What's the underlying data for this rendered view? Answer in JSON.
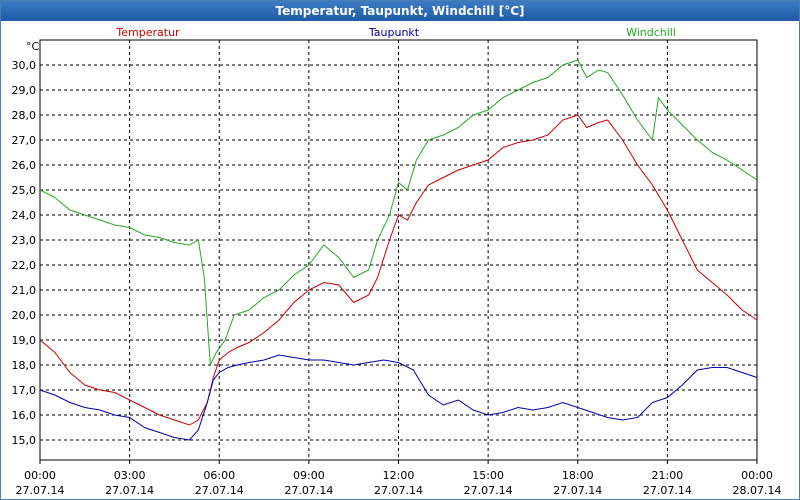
{
  "title": "Temperatur, Taupunkt, Windchill [°C]",
  "chart_data": {
    "type": "line",
    "unit_label": "°C",
    "ylim": [
      14.2,
      31.0
    ],
    "yticks": [
      15.0,
      16.0,
      17.0,
      18.0,
      19.0,
      20.0,
      21.0,
      22.0,
      23.0,
      24.0,
      25.0,
      26.0,
      27.0,
      28.0,
      29.0,
      30.0
    ],
    "ytick_labels": [
      "15,0",
      "16,0",
      "17,0",
      "18,0",
      "19,0",
      "20,0",
      "21,0",
      "22,0",
      "23,0",
      "24,0",
      "25,0",
      "26,0",
      "27,0",
      "28,0",
      "29,0",
      "30,0"
    ],
    "xlim": [
      0,
      24
    ],
    "xticks": [
      0,
      3,
      6,
      9,
      12,
      15,
      18,
      21,
      24
    ],
    "xtick_labels": [
      {
        "time": "00:00",
        "date": "27.07.14"
      },
      {
        "time": "03:00",
        "date": "27.07.14"
      },
      {
        "time": "06:00",
        "date": "27.07.14"
      },
      {
        "time": "09:00",
        "date": "27.07.14"
      },
      {
        "time": "12:00",
        "date": "27.07.14"
      },
      {
        "time": "15:00",
        "date": "27.07.14"
      },
      {
        "time": "18:00",
        "date": "27.07.14"
      },
      {
        "time": "21:00",
        "date": "27.07.14"
      },
      {
        "time": "00:00",
        "date": "28.07.14"
      }
    ],
    "grid": true,
    "legend": "top",
    "series": [
      {
        "name": "Temperatur",
        "color": "#cc0000",
        "x": [
          0,
          0.5,
          1,
          1.5,
          2,
          2.5,
          3,
          3.5,
          4,
          4.5,
          5,
          5.3,
          5.6,
          5.8,
          6,
          6.3,
          6.6,
          7,
          7.5,
          8,
          8.5,
          9,
          9.5,
          10,
          10.5,
          11,
          11.3,
          11.7,
          12,
          12.3,
          12.6,
          13,
          13.5,
          14,
          14.5,
          15,
          15.5,
          16,
          16.5,
          17,
          17.5,
          18,
          18.3,
          18.7,
          19,
          19.5,
          20,
          20.5,
          21,
          21.5,
          22,
          22.5,
          23,
          23.5,
          24
        ],
        "y": [
          19.0,
          18.5,
          17.7,
          17.2,
          17.0,
          16.9,
          16.6,
          16.3,
          16.0,
          15.8,
          15.6,
          15.8,
          16.5,
          17.5,
          18.2,
          18.5,
          18.7,
          18.9,
          19.3,
          19.8,
          20.5,
          21.0,
          21.3,
          21.2,
          20.5,
          20.8,
          21.5,
          23.0,
          24.0,
          23.8,
          24.5,
          25.2,
          25.5,
          25.8,
          26.0,
          26.2,
          26.7,
          26.9,
          27.0,
          27.2,
          27.8,
          28.0,
          27.5,
          27.7,
          27.8,
          27.0,
          26.0,
          25.2,
          24.2,
          23.0,
          21.8,
          21.3,
          20.8,
          20.2,
          19.8
        ]
      },
      {
        "name": "Taupunkt",
        "color": "#0000aa",
        "x": [
          0,
          0.5,
          1,
          1.5,
          2,
          2.5,
          3,
          3.5,
          4,
          4.5,
          5,
          5.3,
          5.6,
          5.8,
          6,
          6.3,
          6.6,
          7,
          7.5,
          8,
          8.5,
          9,
          9.5,
          10,
          10.5,
          11,
          11.5,
          12,
          12.5,
          13,
          13.5,
          14,
          14.5,
          15,
          15.5,
          16,
          16.5,
          17,
          17.5,
          18,
          18.5,
          19,
          19.5,
          20,
          20.5,
          21,
          21.5,
          22,
          22.5,
          23,
          23.5,
          24
        ],
        "y": [
          17.0,
          16.8,
          16.5,
          16.3,
          16.2,
          16.0,
          15.9,
          15.5,
          15.3,
          15.1,
          15.0,
          15.4,
          16.5,
          17.4,
          17.7,
          17.9,
          18.0,
          18.1,
          18.2,
          18.4,
          18.3,
          18.2,
          18.2,
          18.1,
          18.0,
          18.1,
          18.2,
          18.1,
          17.8,
          16.8,
          16.4,
          16.6,
          16.2,
          16.0,
          16.1,
          16.3,
          16.2,
          16.3,
          16.5,
          16.3,
          16.1,
          15.9,
          15.8,
          15.9,
          16.5,
          16.7,
          17.2,
          17.8,
          17.9,
          17.9,
          17.7,
          17.5
        ]
      },
      {
        "name": "Windchill",
        "color": "#22aa22",
        "x": [
          0,
          0.5,
          1,
          1.5,
          2,
          2.5,
          3,
          3.5,
          4,
          4.5,
          5,
          5.3,
          5.5,
          5.7,
          5.9,
          6.2,
          6.5,
          7,
          7.5,
          8,
          8.5,
          9,
          9.5,
          10,
          10.5,
          11,
          11.3,
          11.7,
          12,
          12.3,
          12.6,
          13,
          13.5,
          14,
          14.5,
          15,
          15.5,
          16,
          16.5,
          17,
          17.5,
          18,
          18.3,
          18.7,
          19,
          19.5,
          20,
          20.5,
          20.7,
          21,
          21.5,
          22,
          22.5,
          23,
          23.5,
          24
        ],
        "y": [
          25.0,
          24.7,
          24.2,
          24.0,
          23.8,
          23.6,
          23.5,
          23.2,
          23.1,
          22.9,
          22.8,
          23.0,
          21.5,
          18.0,
          18.5,
          19.0,
          20.0,
          20.2,
          20.7,
          21.0,
          21.6,
          22.0,
          22.8,
          22.3,
          21.5,
          21.8,
          23.0,
          24.0,
          25.3,
          25.0,
          26.2,
          27.0,
          27.2,
          27.5,
          28.0,
          28.2,
          28.7,
          29.0,
          29.3,
          29.5,
          30.0,
          30.2,
          29.5,
          29.8,
          29.7,
          28.8,
          27.8,
          27.0,
          28.7,
          28.2,
          27.6,
          27.0,
          26.5,
          26.2,
          25.8,
          25.4
        ]
      }
    ]
  }
}
